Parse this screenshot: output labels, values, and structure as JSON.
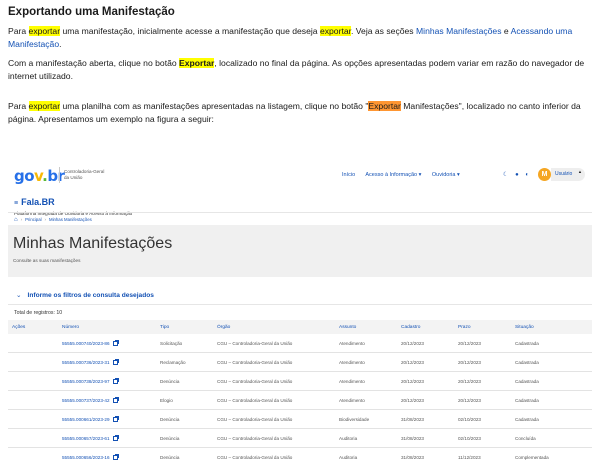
{
  "doc": {
    "title": "Exportando uma Manifestação",
    "p1": {
      "a": "Para ",
      "hl1": "exportar",
      "b": " uma manifestação, inicialmente acesse a manifestação que deseja ",
      "hl2": "exportar",
      "c": ". Veja as seções ",
      "link1": "Minhas Manifestações",
      "d": " e ",
      "link2": "Acessando uma Manifestação",
      "e": "."
    },
    "p2": {
      "a": "Com a manifestação aberta, clique no botão ",
      "hl": "Exportar",
      "b": ", localizado no final da página. As opções apresentadas podem variar em razão do navegador de internet utilizado."
    },
    "p3": {
      "a": "Para ",
      "hl": "exportar",
      "b": " uma planilha com as manifestações apresentadas na listagem, clique no botão \"",
      "hl_orange": "Exportar",
      "c": " Manifestações\", localizado no canto inferior da página. Apresentamos um exemplo na figura a seguir:"
    }
  },
  "screenshot": {
    "logo": {
      "p1": "go",
      "p2": "v",
      "p3": ".",
      "p4": "br"
    },
    "org_line1": "Controladoria-Geral",
    "org_line2": "da União",
    "nav": [
      "Início",
      "Acesso à Informação ▾",
      "Ouvidoria ▾"
    ],
    "nav_icons": [
      "moon-icon",
      "dot-icon",
      "contrast-icon"
    ],
    "avatar_letter": "M",
    "user_label": "Usuário",
    "brand_title": "Fala.BR",
    "brand_sub": "Plataforma Integrada de Ouvidoria e Acesso à Informação",
    "breadcrumb": [
      "Principal",
      "Minhas Manifestações"
    ],
    "page_title": "Minhas Manifestações",
    "page_sub": "Consulte as suas manifestações",
    "filters_label": "Informe os filtros de consulta desejados",
    "total": "Total de registros: 10",
    "columns": [
      "Ações",
      "Número",
      "Tipo",
      "Órgão",
      "Assunto",
      "Cadastro",
      "Prazo",
      "Situação"
    ],
    "rows": [
      [
        "",
        "55555.000740/2023-86",
        "Solicitação",
        "CGU – Controladoria-Geral da União",
        "Atendimento",
        "20/12/2023",
        "20/12/2023",
        "Cadastrada"
      ],
      [
        "",
        "55555.000736/2023-31",
        "Reclamação",
        "CGU – Controladoria-Geral da União",
        "Atendimento",
        "20/12/2023",
        "20/12/2023",
        "Cadastrada"
      ],
      [
        "",
        "55555.000738/2023-97",
        "Denúncia",
        "CGU – Controladoria-Geral da União",
        "Atendimento",
        "20/12/2023",
        "20/12/2023",
        "Cadastrada"
      ],
      [
        "",
        "55555.000737/2023-42",
        "Elogio",
        "CGU – Controladoria-Geral da União",
        "Atendimento",
        "20/12/2023",
        "20/12/2023",
        "Cadastrada"
      ],
      [
        "",
        "55555.000661/2023-29",
        "Denúncia",
        "CGU – Controladoria-Geral da União",
        "Biodiversidade",
        "31/08/2023",
        "02/10/2023",
        "Cadastrada"
      ],
      [
        "",
        "55555.000657/2023-61",
        "Denúncia",
        "CGU – Controladoria-Geral da União",
        "Auditoria",
        "31/08/2023",
        "02/10/2023",
        "Concluída"
      ],
      [
        "",
        "55555.000656/2023-16",
        "Denúncia",
        "CGU – Controladoria-Geral da União",
        "Auditoria",
        "31/08/2023",
        "11/12/2023",
        "Complementada"
      ]
    ]
  }
}
